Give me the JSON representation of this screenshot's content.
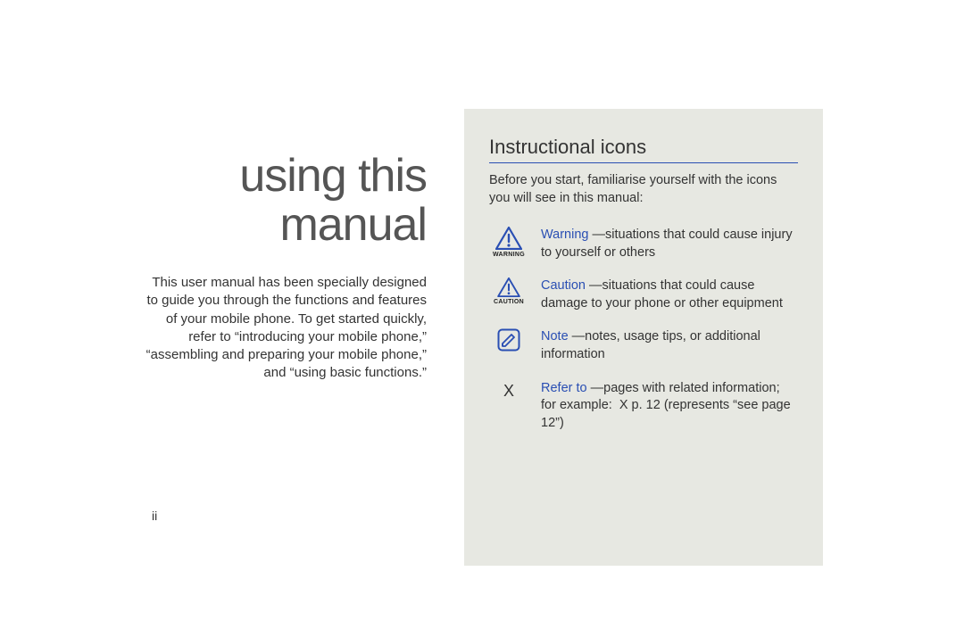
{
  "left": {
    "title_line1": "using this",
    "title_line2": "manual",
    "intro": "This user manual has been specially designed to guide you through the functions and features of your mobile phone. To get started quickly, refer to “introducing your mobile phone,” “assembling and preparing your mobile phone,” and “using basic functions.”",
    "page_number": "ii"
  },
  "right": {
    "section_title": "Instructional icons",
    "lead": "Before you start, familiarise yourself with the icons you will see in this manual:",
    "items": [
      {
        "icon_caption": "WARNING",
        "term": "Warning",
        "desc": "—situations that could cause injury to yourself or others"
      },
      {
        "icon_caption": "CAUTION",
        "term": "Caution",
        "desc": "—situations that could cause damage to your phone or other equipment"
      },
      {
        "icon_caption": "",
        "term": "Note",
        "desc": "—notes, usage tips, or additional information"
      },
      {
        "icon_glyph": "X",
        "term": "Refer to",
        "desc": "—pages with related information; for example:  X p. 12 (represents “see page 12”)"
      }
    ]
  }
}
